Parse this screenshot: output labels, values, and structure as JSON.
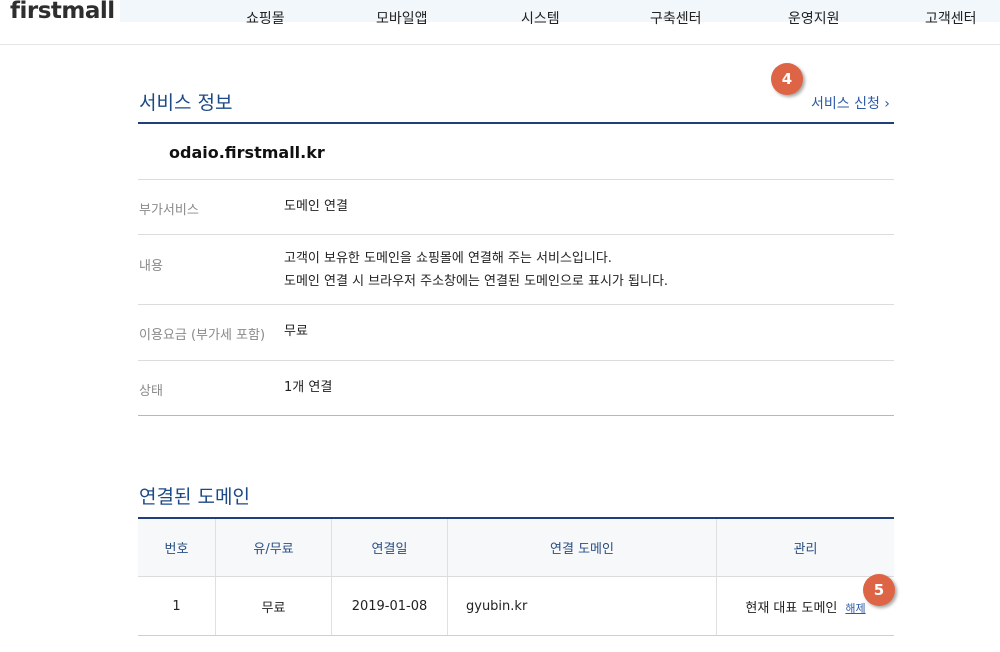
{
  "header": {
    "logo": "firstmall",
    "nav": [
      "쇼핑몰",
      "모바일앱",
      "시스템",
      "구축센터",
      "운영지원",
      "고객센터"
    ]
  },
  "service_info": {
    "title": "서비스 정보",
    "apply_link": "서비스 신청 ›",
    "badge": "4",
    "domain": "odaio.firstmall.kr",
    "rows": [
      {
        "label": "부가서비스",
        "value": "도메인 연결"
      },
      {
        "label": "내용",
        "value_lines": [
          "고객이 보유한 도메인을 쇼핑몰에 연결해 주는 서비스입니다.",
          "도메인 연결 시 브라우저 주소창에는 연결된 도메인으로 표시가 됩니다."
        ]
      },
      {
        "label": "이용요금 (부가세 포함)",
        "value": "무료"
      },
      {
        "label": "상태",
        "value": "1개 연결"
      }
    ]
  },
  "linked_domains": {
    "title": "연결된 도메인",
    "columns": [
      "번호",
      "유/무료",
      "연결일",
      "연결 도메인",
      "관리"
    ],
    "rows": [
      {
        "no": "1",
        "type": "무료",
        "date": "2019-01-08",
        "domain": "gyubin.kr",
        "manage": "현재 대표 도메인",
        "action": "해제"
      }
    ],
    "badge": "5"
  },
  "colors": {
    "accent": "#1c4a86",
    "badge": "#dd6444",
    "link": "#2d5aa6"
  }
}
